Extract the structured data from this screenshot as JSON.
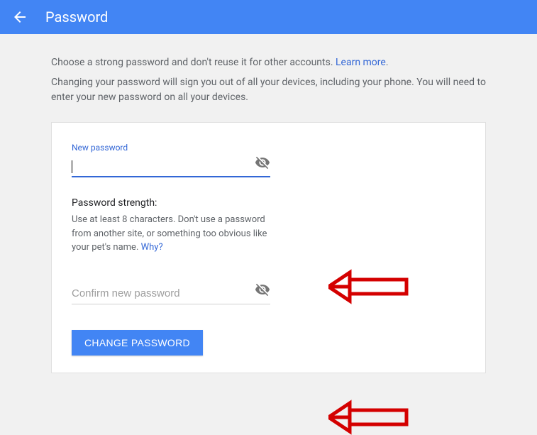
{
  "header": {
    "title": "Password"
  },
  "intro": {
    "line1": "Choose a strong password and don't reuse it for other accounts. ",
    "learn_more": "Learn more",
    "line2": "Changing your password will sign you out of all your devices, including your phone. You will need to enter your new password on all your devices."
  },
  "form": {
    "new_password_label": "New password",
    "new_password_value": "",
    "strength_title": "Password strength:",
    "strength_text": "Use at least 8 characters. Don't use a password from another site, or something too obvious like your pet's name. ",
    "why_label": "Why?",
    "confirm_placeholder": "Confirm new password",
    "confirm_value": "",
    "submit_label": "CHANGE PASSWORD"
  }
}
